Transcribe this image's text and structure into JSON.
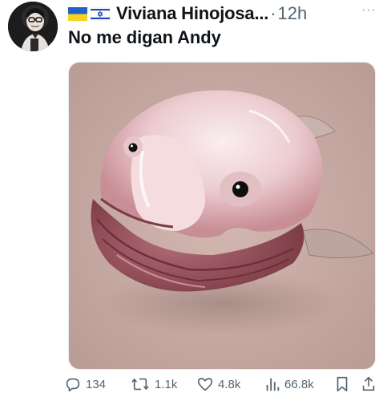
{
  "tweet": {
    "author_name": "Viviana Hinojosa...",
    "separator": "·",
    "time": "12h",
    "more_label": "···",
    "text": "No me digan Andy"
  },
  "actions": {
    "replies": "134",
    "reposts": "1.1k",
    "likes": "4.8k",
    "views": "66.8k"
  },
  "icons": [
    "ukraine-flag-icon",
    "israel-flag-icon",
    "reply-icon",
    "repost-icon",
    "like-icon",
    "views-icon",
    "bookmark-icon",
    "share-icon",
    "more-icon"
  ],
  "colors": {
    "text": "#0f1419",
    "muted": "#536471",
    "media_bg": "#c9aca6"
  }
}
